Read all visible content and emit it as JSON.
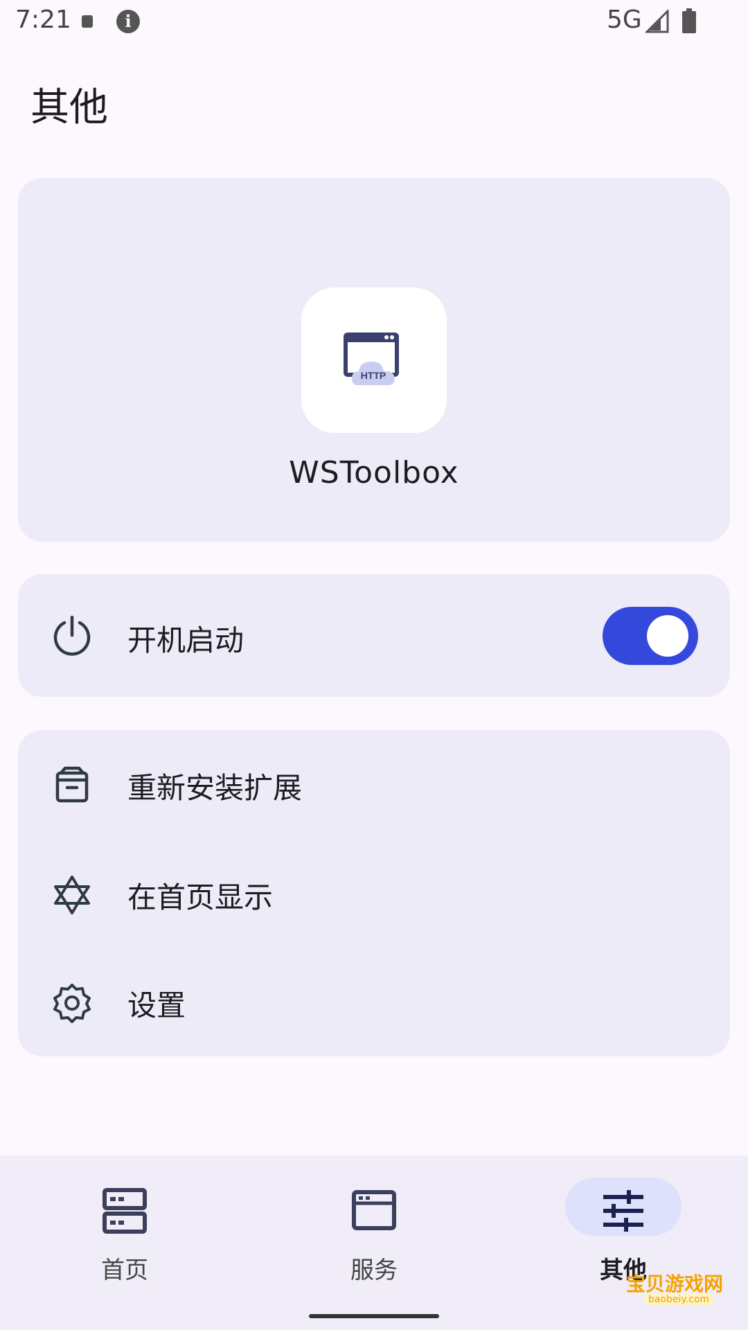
{
  "status_bar": {
    "time": "7:21",
    "info_glyph": "i",
    "network": "5G",
    "icons": [
      "notification-icon",
      "info-icon",
      "signal-icon",
      "battery-icon"
    ]
  },
  "page": {
    "title": "其他"
  },
  "app_card": {
    "icon": "http-browser-icon",
    "icon_text": "HTTP",
    "name": "WSToolbox"
  },
  "boot_start": {
    "icon": "power-icon",
    "label": "开机启动",
    "enabled": true,
    "accent_color": "#3449dc"
  },
  "menu": {
    "items": [
      {
        "icon": "archive-box-icon",
        "label": "重新安装扩展"
      },
      {
        "icon": "star-of-david-icon",
        "label": "在首页显示"
      },
      {
        "icon": "gear-icon",
        "label": "设置"
      }
    ]
  },
  "bottom_nav": {
    "items": [
      {
        "icon": "server-icon",
        "label": "首页"
      },
      {
        "icon": "window-icon",
        "label": "服务"
      },
      {
        "icon": "sliders-icon",
        "label": "其他",
        "active": true
      }
    ]
  },
  "watermark": {
    "title": "宝贝游戏网",
    "sub": "baobeiy.com"
  }
}
